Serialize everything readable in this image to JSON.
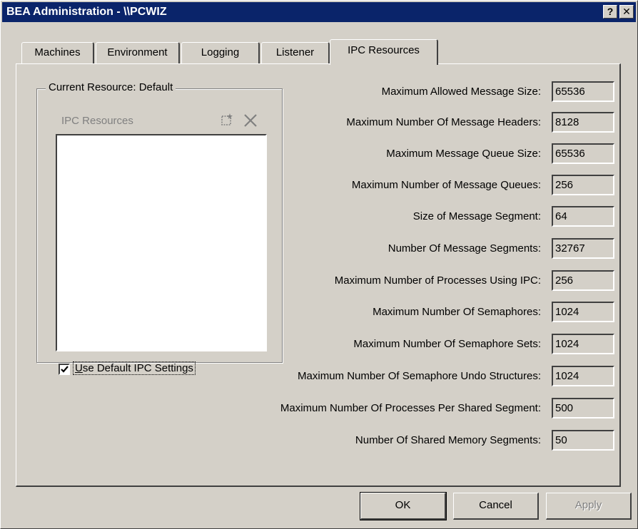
{
  "window": {
    "title": "BEA Administration - \\\\PCWIZ",
    "help_glyph": "?",
    "close_glyph": "✕"
  },
  "tabs": [
    {
      "label": "Machines",
      "active": false
    },
    {
      "label": "Environment",
      "active": false
    },
    {
      "label": "Logging",
      "active": false
    },
    {
      "label": "Listener",
      "active": false
    },
    {
      "label": "IPC Resources",
      "active": true
    }
  ],
  "resource_group": {
    "legend": "Current Resource: Default",
    "list_header": "IPC Resources",
    "new_icon": "new-item-icon",
    "delete_icon": "delete-icon",
    "items": []
  },
  "use_default": {
    "checked": true,
    "label_first": "U",
    "label_rest": "se Default IPC Settings"
  },
  "fields": [
    {
      "label": "Maximum Allowed Message Size:",
      "value": "65536"
    },
    {
      "label": "Maximum Number Of Message Headers:",
      "value": "8128"
    },
    {
      "label": "Maximum Message Queue Size:",
      "value": "65536"
    },
    {
      "label": "Maximum Number of Message Queues:",
      "value": "256"
    },
    {
      "label": "Size of Message Segment:",
      "value": "64"
    },
    {
      "label": "Number Of Message Segments:",
      "value": "32767"
    },
    {
      "label": "Maximum Number of Processes Using IPC:",
      "value": "256"
    },
    {
      "label": "Maximum Number Of Semaphores:",
      "value": "1024"
    },
    {
      "label": "Maximum Number Of Semaphore Sets:",
      "value": "1024"
    },
    {
      "label": "Maximum Number Of Semaphore Undo Structures:",
      "value": "1024"
    },
    {
      "label": "Maximum Number Of Processes Per Shared Segment:",
      "value": "500"
    },
    {
      "label": "Number Of Shared Memory Segments:",
      "value": "50"
    }
  ],
  "buttons": {
    "ok": "OK",
    "cancel": "Cancel",
    "apply": "Apply"
  },
  "colors": {
    "titlebar": "#0a246a",
    "face": "#d4d0c8"
  }
}
